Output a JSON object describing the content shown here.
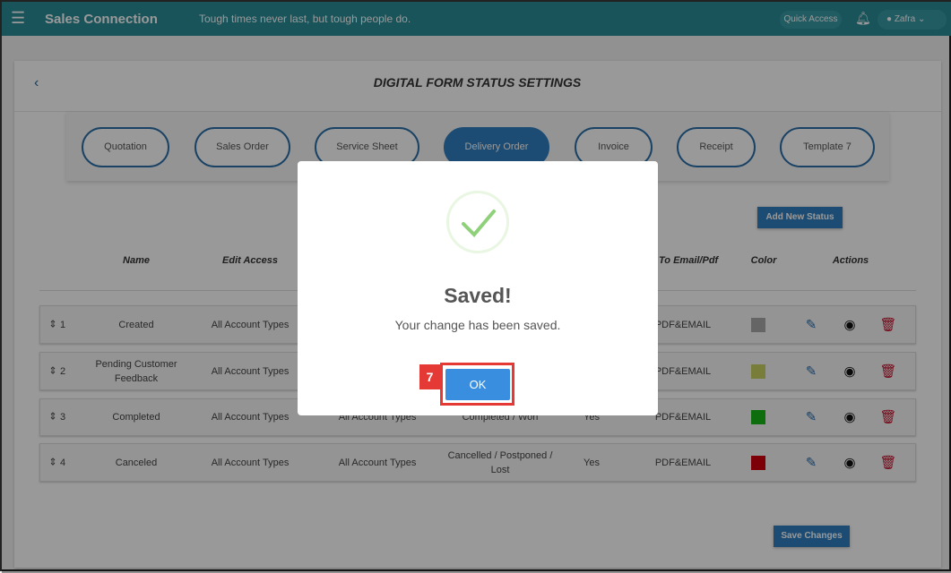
{
  "header": {
    "brand": "Sales Connection",
    "motto": "Tough times never last, but tough people do.",
    "quick_access": "Quick Access",
    "user": "Zafra"
  },
  "page": {
    "title": "DIGITAL FORM STATUS SETTINGS"
  },
  "tabs": [
    {
      "label": "Quotation"
    },
    {
      "label": "Sales Order"
    },
    {
      "label": "Service Sheet"
    },
    {
      "label": "Delivery Order",
      "active": true
    },
    {
      "label": "Invoice"
    },
    {
      "label": "Receipt"
    },
    {
      "label": "Template 7"
    }
  ],
  "add_new_status": "Add New Status",
  "columns": {
    "name": "Name",
    "edit_access": "Edit Access",
    "email_pdf": "le To Email/Pdf",
    "color": "Color",
    "actions": "Actions"
  },
  "rows": [
    {
      "order": "1",
      "name": "Created",
      "edit_access": "All Account Types",
      "col3": "",
      "col4": "",
      "col5": "",
      "email_pdf": "PDF&EMAIL",
      "color": "#a8a8a8"
    },
    {
      "order": "2",
      "name": "Pending Customer Feedback",
      "edit_access": "All Account Types",
      "col3": "",
      "col4": "",
      "col5": "",
      "email_pdf": "PDF&EMAIL",
      "color": "#c8d060"
    },
    {
      "order": "3",
      "name": "Completed",
      "edit_access": "All Account Types",
      "col3": "All Account Types",
      "col4": "Completed / Won",
      "col5": "Yes",
      "email_pdf": "PDF&EMAIL",
      "color": "#18b818"
    },
    {
      "order": "4",
      "name": "Canceled",
      "edit_access": "All Account Types",
      "col3": "All Account Types",
      "col4": "Cancelled / Postponed / Lost",
      "col5": "Yes",
      "email_pdf": "PDF&EMAIL",
      "color": "#d00010"
    }
  ],
  "save_changes": "Save Changes",
  "modal": {
    "title": "Saved!",
    "message": "Your change has been saved.",
    "ok": "OK",
    "step": "7"
  }
}
